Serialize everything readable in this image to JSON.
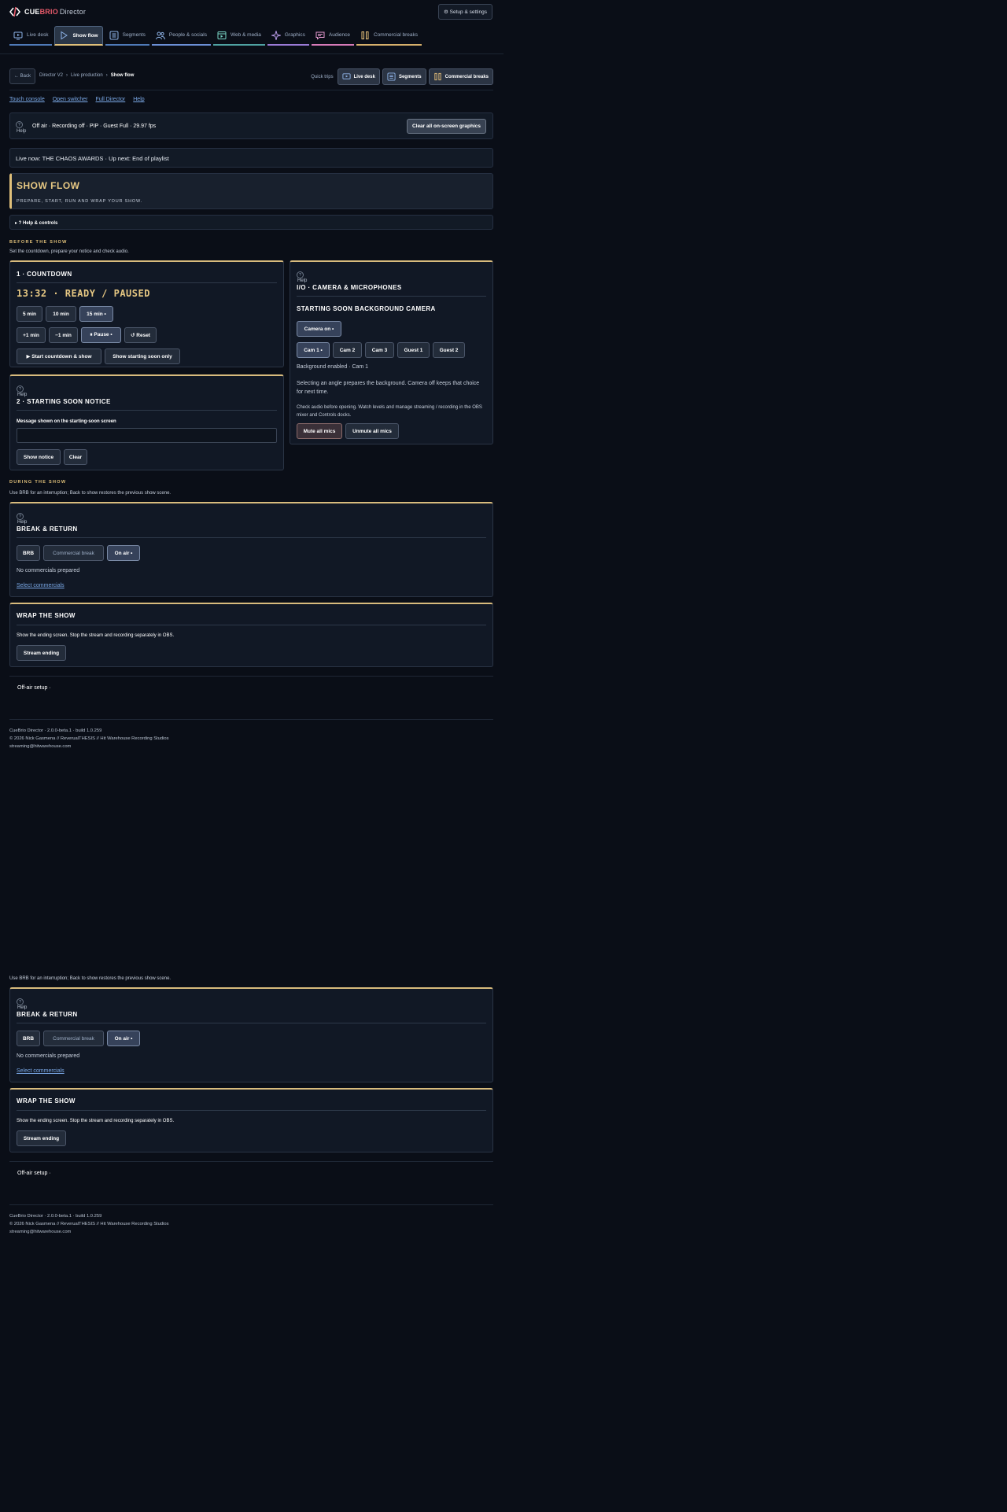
{
  "app": {
    "logo_cue": "CUE",
    "logo_brio": "BRIO",
    "logo_director": "Director",
    "setup_button": "⚙ Setup & settings"
  },
  "nav": {
    "tabs": [
      {
        "label": "Live desk",
        "icon": "monitor-play-icon"
      },
      {
        "label": "Show flow",
        "icon": "play-icon"
      },
      {
        "label": "Segments",
        "icon": "list-icon"
      },
      {
        "label": "People & socials",
        "icon": "people-icon"
      },
      {
        "label": "Web & media",
        "icon": "web-media-icon"
      },
      {
        "label": "Graphics",
        "icon": "sparkle-icon"
      },
      {
        "label": "Audience",
        "icon": "chat-icon"
      },
      {
        "label": "Commercial breaks",
        "icon": "pause-bars-icon"
      }
    ],
    "active_index": 1
  },
  "breadcrumb": {
    "back": "← Back",
    "items": [
      "Director V2",
      "Live production",
      "Show flow"
    ],
    "separator": "›",
    "quick_label": "Quick trips",
    "quick": [
      "Live desk",
      "Segments",
      "Commercial breaks"
    ]
  },
  "links": [
    "Touch console",
    "Open switcher",
    "Full Director",
    "Help"
  ],
  "status": {
    "help_icon": "?",
    "help_label": "Help",
    "text": "Off air · Recording off · PIP · Guest Full · 29.97 fps",
    "clear_button": "Clear all on-screen graphics"
  },
  "live_now": "Live now: THE CHAOS AWARDS · Up next: End of playlist",
  "hero": {
    "title": "SHOW FLOW",
    "subtitle": "PREPARE, START, RUN AND WRAP YOUR SHOW."
  },
  "help_controls": "▸ ? Help & controls",
  "before": {
    "heading": "BEFORE THE SHOW",
    "desc": "Set the countdown, prepare your notice and check audio."
  },
  "countdown": {
    "title": "1 · COUNTDOWN",
    "display": "13:32 · READY / PAUSED",
    "presets": [
      "5 min",
      "10 min",
      "15 min •"
    ],
    "adjust": [
      "+1 min",
      "−1 min",
      "⏸ Pause •",
      "↺ Reset"
    ],
    "start": "▶ Start countdown & show",
    "soon_only": "Show starting soon only"
  },
  "notice": {
    "help_icon": "?",
    "help_label": "Help",
    "title": "2 · STARTING SOON NOTICE",
    "label": "Message shown on the starting-soon screen",
    "input_value": "",
    "show_button": "Show notice",
    "clear_button": "Clear"
  },
  "io": {
    "help_icon": "?",
    "help_label": "Help",
    "title": "I/O · CAMERA & MICROPHONES",
    "subtitle": "STARTING SOON BACKGROUND CAMERA",
    "camera_on": "Camera on •",
    "cams": [
      "Cam 1 •",
      "Cam 2",
      "Cam 3",
      "Guest 1",
      "Guest 2"
    ],
    "bg_status": "Background enabled · Cam 1",
    "desc1": "Selecting an angle prepares the background. Camera off keeps that choice for next time.",
    "desc2": "Check audio before opening. Watch levels and manage streaming / recording in the OBS mixer and Controls docks.",
    "mute_all": "Mute all mics",
    "unmute_all": "Unmute all mics"
  },
  "during": {
    "heading": "DURING THE SHOW",
    "desc": "Use BRB for an interruption; Back to show restores the previous show scene."
  },
  "break": {
    "help_icon": "?",
    "help_label": "Help",
    "title": "BREAK & RETURN",
    "buttons": [
      "BRB",
      "Commercial break",
      "On air •"
    ],
    "no_commercials": "No commercials prepared",
    "select_link": "Select commercials"
  },
  "wrap": {
    "title": "WRAP THE SHOW",
    "desc": "Show the ending screen. Stop the stream and recording separately in OBS.",
    "button": "Stream ending"
  },
  "offair": "Off-air setup ·",
  "footer": {
    "line1": "CueBrio Director · 2.0.0-beta.1 · build 1.0.259",
    "line2": "© 2026 Nick Gasmena // ReverualTHESIS // Hit Warehouse Recording Studios",
    "line3": "streaming@hitwarehouse.com"
  },
  "colors": {
    "background": "#0a0e17",
    "accent_gold": "#e0c07a",
    "link_blue": "#7aa8e6",
    "brand_red": "#e85a6a"
  }
}
